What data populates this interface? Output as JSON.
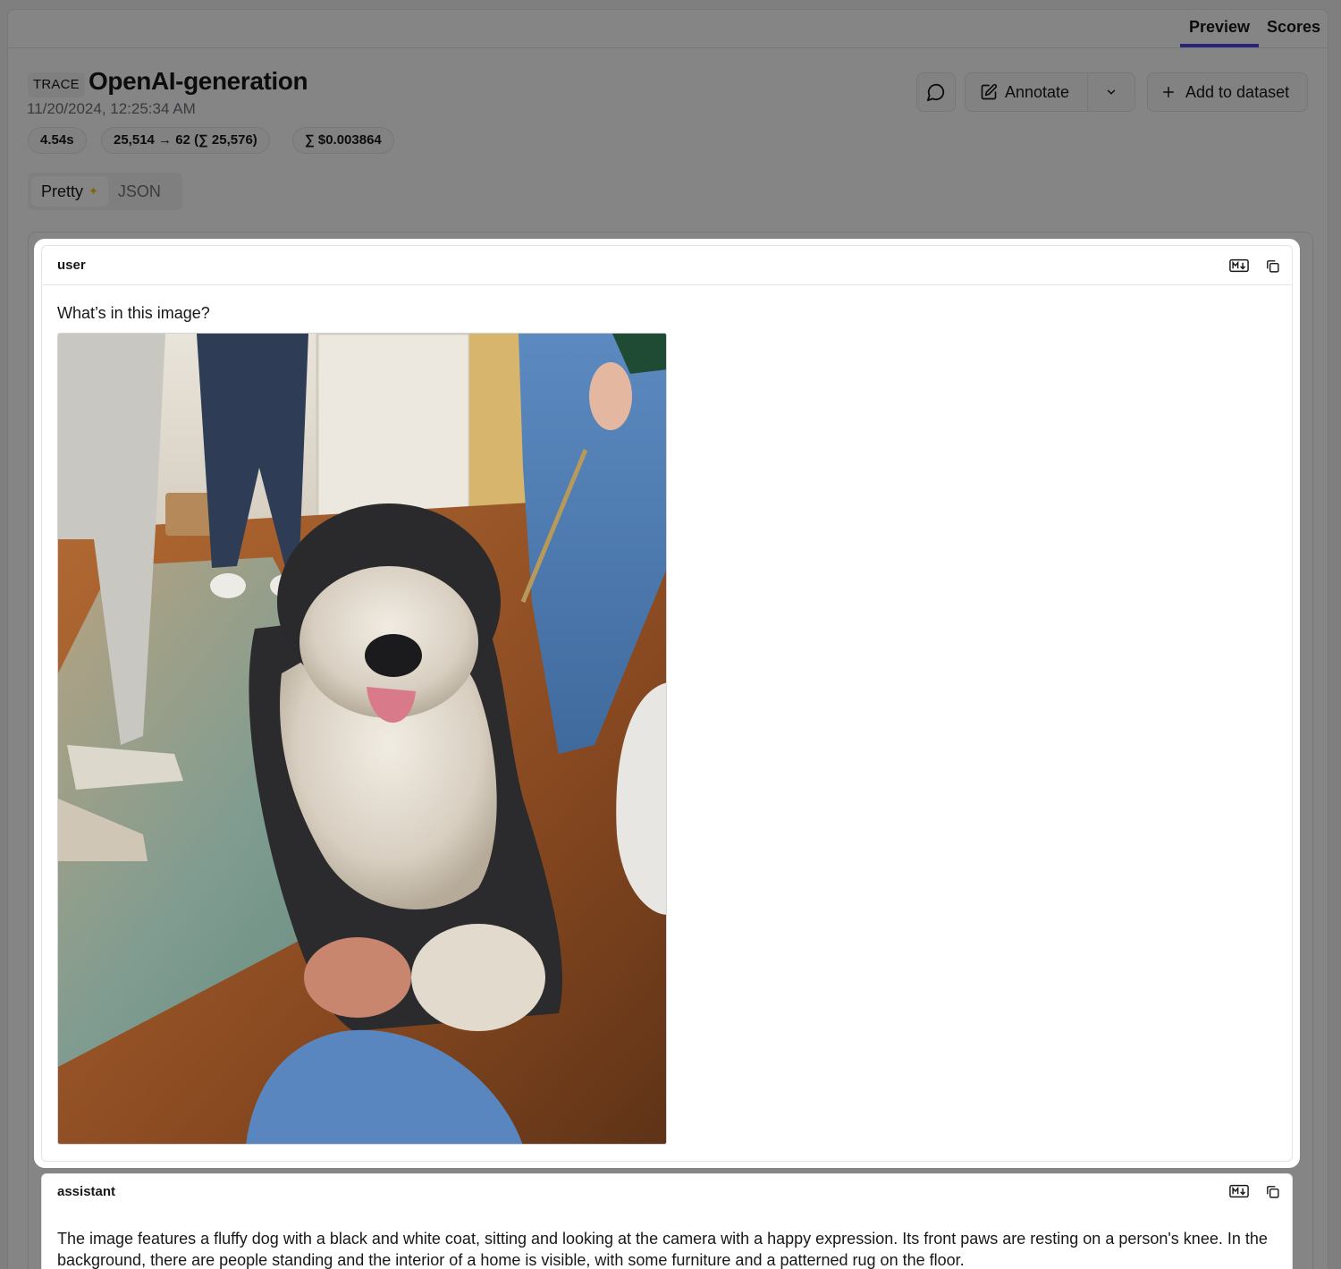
{
  "tabs": [
    {
      "label": "Preview",
      "active": true
    },
    {
      "label": "Scores",
      "active": false
    }
  ],
  "trace": {
    "badge": "TRACE",
    "title": "OpenAI-generation",
    "timestamp": "11/20/2024, 12:25:34 AM",
    "latency": "4.54s",
    "tokens": "25,514 → 62 (∑ 25,576)",
    "cost": "∑ $0.003864"
  },
  "actions": {
    "comment_icon": "message-circle-icon",
    "annotate_label": "Annotate",
    "add_dataset_label": "Add to dataset"
  },
  "view_toggle": {
    "pretty": "Pretty",
    "json": "JSON",
    "selected": "Pretty"
  },
  "messages": {
    "user": {
      "role": "user",
      "text": "What’s in this image?",
      "image_description_icon": "photo"
    },
    "assistant": {
      "role": "assistant",
      "text": "The image features a fluffy dog with a black and white coat, sitting and looking at the camera with a happy expression. Its front paws are resting on a person's knee. In the background, there are people standing and the interior of a home is visible, with some furniture and a patterned rug on the floor."
    }
  },
  "colors": {
    "accent": "#4f46e5",
    "overlay": "rgba(0,0,0,0.48)"
  }
}
